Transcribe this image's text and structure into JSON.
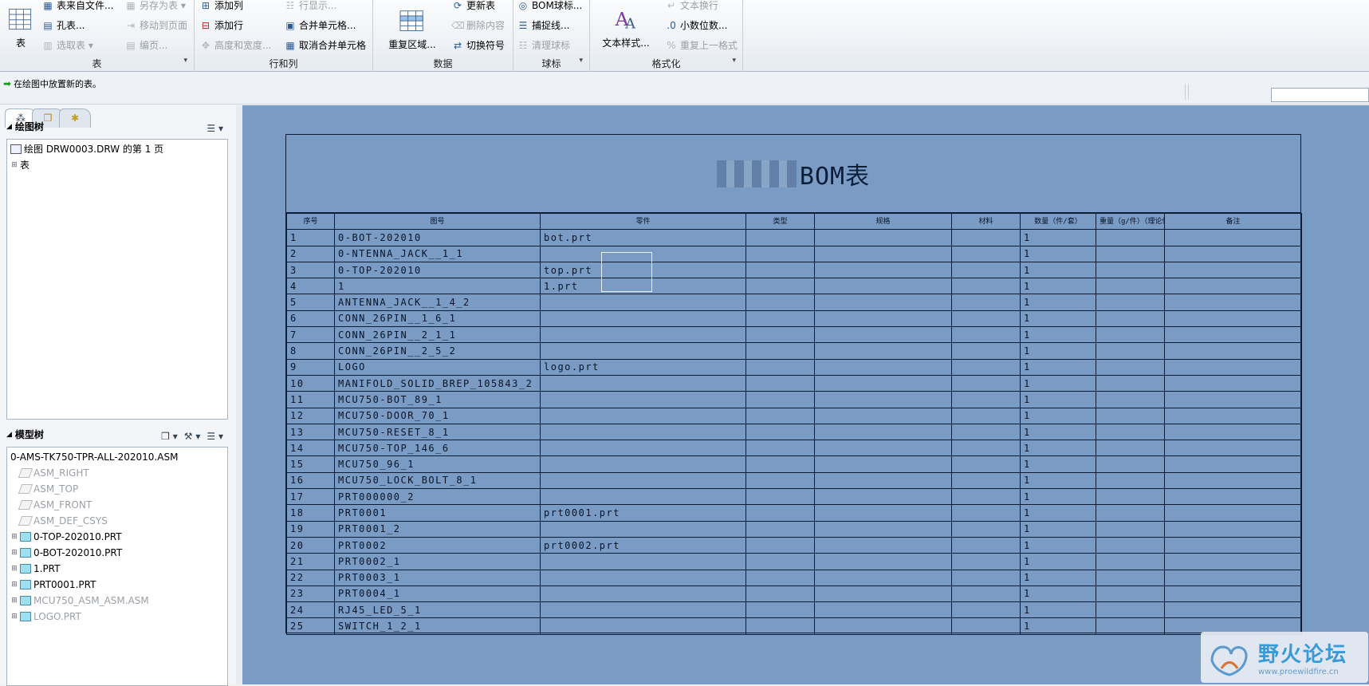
{
  "ribbon": {
    "table_group": {
      "label": "表",
      "big": "表",
      "items": [
        "表来自文件...",
        "孔表...",
        "选取表",
        "另存为表",
        "移动到页面",
        "编页..."
      ]
    },
    "rowcol_group": {
      "label": "行和列",
      "items": [
        "添加列",
        "添加行",
        "高度和宽度...",
        "行显示...",
        "合并单元格...",
        "取消合并单元格"
      ]
    },
    "data_group": {
      "label": "数据",
      "big": "重复区域...",
      "items": [
        "更新表",
        "删除内容",
        "切换符号"
      ]
    },
    "balloon_group": {
      "label": "球标",
      "items": [
        "BOM球标...",
        "捕捉线...",
        "清理球标"
      ]
    },
    "format_group": {
      "label": "格式化",
      "big": "文本样式...",
      "items": [
        "文本换行",
        "小数位数...",
        "重复上一格式"
      ]
    }
  },
  "status": {
    "message": "在绘图中放置新的表。"
  },
  "drawing_tree": {
    "title": "绘图树",
    "root": "绘图 DRW0003.DRW 的第 1 页",
    "child": "表"
  },
  "model_tree": {
    "title": "模型树",
    "root": "0-AMS-TK750-TPR-ALL-202010.ASM",
    "items": [
      {
        "label": "ASM_RIGHT",
        "gray": true,
        "expand": false
      },
      {
        "label": "ASM_TOP",
        "gray": true,
        "expand": false
      },
      {
        "label": "ASM_FRONT",
        "gray": true,
        "expand": false
      },
      {
        "label": "ASM_DEF_CSYS",
        "gray": true,
        "expand": false
      },
      {
        "label": "0-TOP-202010.PRT",
        "gray": false,
        "expand": true
      },
      {
        "label": "0-BOT-202010.PRT",
        "gray": false,
        "expand": true
      },
      {
        "label": "1.PRT",
        "gray": false,
        "expand": true
      },
      {
        "label": "PRT0001.PRT",
        "gray": false,
        "expand": true
      },
      {
        "label": "MCU750_ASM_ASM.ASM",
        "gray": true,
        "expand": true
      },
      {
        "label": "LOGO.PRT",
        "gray": true,
        "expand": true
      }
    ]
  },
  "bom": {
    "title": "BOM表",
    "headers": [
      "序号",
      "图号",
      "零件",
      "类型",
      "规格",
      "材料",
      "数量（件/套）",
      "重量（g/件）（理论值仅供参考）",
      "备注"
    ],
    "rows": [
      [
        "1",
        "0-BOT-202010",
        "bot.prt",
        "1"
      ],
      [
        "2",
        "0-NTENNA_JACK__1_1",
        "",
        "1"
      ],
      [
        "3",
        "0-TOP-202010",
        "top.prt",
        "1"
      ],
      [
        "4",
        "1",
        "1.prt",
        "1"
      ],
      [
        "5",
        "ANTENNA_JACK__1_4_2",
        "",
        "1"
      ],
      [
        "6",
        "CONN_26PIN__1_6_1",
        "",
        "1"
      ],
      [
        "7",
        "CONN_26PIN__2_1_1",
        "",
        "1"
      ],
      [
        "8",
        "CONN_26PIN__2_5_2",
        "",
        "1"
      ],
      [
        "9",
        "LOGO",
        "logo.prt",
        "1"
      ],
      [
        "10",
        "MANIFOLD_SOLID_BREP_105843_2",
        "",
        "1"
      ],
      [
        "11",
        "MCU750-BOT_89_1",
        "",
        "1"
      ],
      [
        "12",
        "MCU750-DOOR_70_1",
        "",
        "1"
      ],
      [
        "13",
        "MCU750-RESET_8_1",
        "",
        "1"
      ],
      [
        "14",
        "MCU750-TOP_146_6",
        "",
        "1"
      ],
      [
        "15",
        "MCU750_96_1",
        "",
        "1"
      ],
      [
        "16",
        "MCU750_LOCK_BOLT_8_1",
        "",
        "1"
      ],
      [
        "17",
        "PRT000000_2",
        "",
        "1"
      ],
      [
        "18",
        "PRT0001",
        "prt0001.prt",
        "1"
      ],
      [
        "19",
        "PRT0001_2",
        "",
        "1"
      ],
      [
        "20",
        "PRT0002",
        "prt0002.prt",
        "1"
      ],
      [
        "21",
        "PRT0002_1",
        "",
        "1"
      ],
      [
        "22",
        "PRT0003_1",
        "",
        "1"
      ],
      [
        "23",
        "PRT0004_1",
        "",
        "1"
      ],
      [
        "24",
        "RJ45_LED_5_1",
        "",
        "1"
      ],
      [
        "25",
        "SWITCH_1_2_1",
        "",
        "1"
      ]
    ]
  },
  "watermark": {
    "name": "野火论坛",
    "url": "www.proewildfire.cn"
  }
}
